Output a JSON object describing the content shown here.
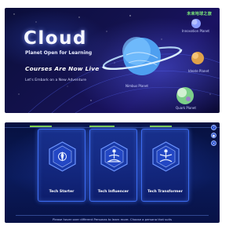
{
  "landing": {
    "brand": "未来地球之旅",
    "title": "Cloud",
    "subtitle": "Planet Open for Learning",
    "headline": "Courses Are Now Live",
    "tagline": "Let's Embark on a New Adventure",
    "planets": [
      {
        "label": "Nimbus Planet"
      },
      {
        "label": "Innovation Planet"
      },
      {
        "label": "Ideate Planet"
      },
      {
        "label": "Quark Planet"
      }
    ],
    "colors": {
      "background": "#120f4d",
      "brand": "#7ff07a",
      "ring_planet": "#6db8ff"
    }
  },
  "levels": {
    "cards": [
      {
        "label": "Tech Starter",
        "icon": "rocket-icon"
      },
      {
        "label": "Tech Influencer",
        "icon": "meditation-figure-icon"
      },
      {
        "label": "Tech Transformer",
        "icon": "meditation-figure-icon"
      }
    ],
    "side_tools": [
      {
        "glyph": "?",
        "icon": "help-icon"
      },
      {
        "glyph": "●",
        "icon": "record-icon"
      },
      {
        "glyph": "✕",
        "icon": "close-icon"
      }
    ],
    "footer": "Please hover over different Personas to learn more. Choose a persona that suits",
    "colors": {
      "accent": "#7fd14a",
      "card_border": "#3d6cf0"
    }
  }
}
